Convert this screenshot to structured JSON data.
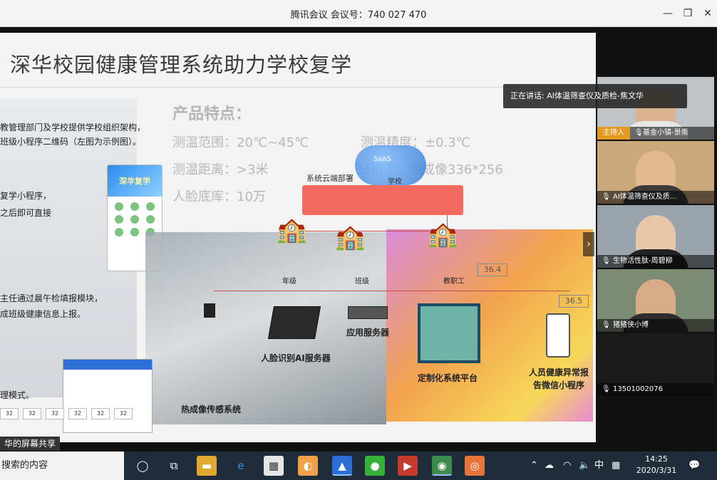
{
  "window": {
    "title": "腾讯会议 会议号：740 027 470",
    "minimize_glyph": "—",
    "restore_glyph": "❐",
    "close_glyph": "✕"
  },
  "slide": {
    "title": "深华校园健康管理系统助力学校复学",
    "left_lines": [
      "教管理部门及学校提供学校组织架构，",
      "班级小程序二维码（左图为示例图）。",
      "复学小程序，",
      "之后即可直接",
      "主任通过晨午检填报模块，",
      "成班级健康信息上报。",
      "理模式。"
    ],
    "phone_title": "深华复学",
    "features_title": "产品特点：",
    "features": [
      "测温范围：20℃~45℃",
      "测温距离：>3米",
      "人脸底库：10万"
    ],
    "features_right": [
      "测温精度：±0.3℃",
      "分辨率：热成像336*256"
    ],
    "cloud_deploy": "系统云端部署",
    "cloud_text": "SaaS",
    "school": "学校",
    "buildings": [
      "年级",
      "班级",
      "教职工"
    ],
    "components": [
      "人脸识别AI服务器",
      "应用服务器",
      "定制化系统平台",
      "人员健康异常报",
      "告微信小程序",
      "热成像传感系统"
    ],
    "temp_tags": [
      "36.4",
      "36.5"
    ],
    "chips": [
      "32",
      "32",
      "32",
      "32",
      "32",
      "32"
    ],
    "next_arrow": "›"
  },
  "screen_share": {
    "label": "华的屏幕共享"
  },
  "speaking_toast": "正在讲话: AI体温筛查仪及质检-焦文华",
  "participants": [
    {
      "name": "基金小镇-景南",
      "host_badge": "主持人"
    },
    {
      "name": "AI体温筛查仪及质..."
    },
    {
      "name": "生物活性肽-周碧柳"
    },
    {
      "name": "猪猪侠小博"
    },
    {
      "name": "13501002076"
    }
  ],
  "taskbar": {
    "search_placeholder": "搜索的内容",
    "ime": "中",
    "time": "14:25",
    "date": "2020/3/31"
  }
}
